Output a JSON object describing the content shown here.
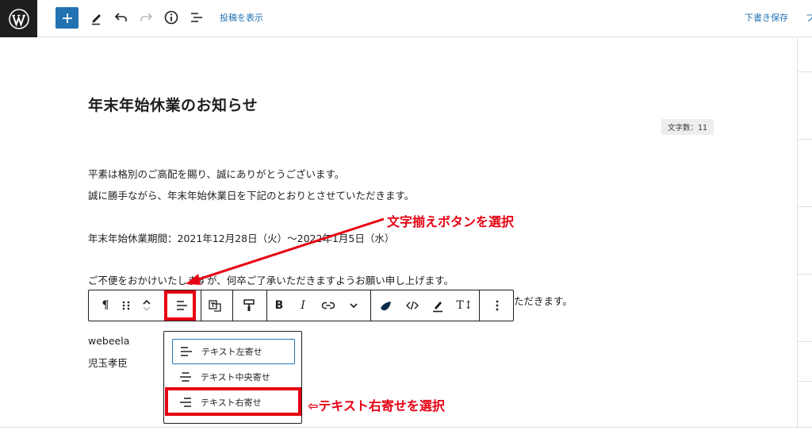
{
  "topbar": {
    "view_post": "投稿を表示",
    "save_draft": "下書き保存",
    "cut_text": "プ"
  },
  "post": {
    "title": "年末年始休業のお知らせ",
    "char_count": "文字数：11",
    "lines": [
      "平素は格別のご高配を賜り、誠にありがとうございます。",
      "誠に勝手ながら、年末年始休業日を下記のとおりとさせていただきます。",
      "年末年始休業期間：2021年12月28日（火）〜2022年1月5日（水）",
      "ご不便をおかけいたしますが、何卒ご了承いただきますようお願い申し上げます。",
      "ただきます。",
      "webeela",
      "児玉孝臣"
    ]
  },
  "block_toolbar": {
    "bold": "B",
    "italic": "I",
    "text_size": "T↕",
    "paragraph": "¶"
  },
  "align_menu": {
    "items": [
      {
        "label": "テキスト左寄せ",
        "icon": "align-left-icon"
      },
      {
        "label": "テキスト中央寄せ",
        "icon": "align-center-icon"
      },
      {
        "label": "テキスト右寄せ",
        "icon": "align-right-icon"
      }
    ]
  },
  "annotations": {
    "select_align_button": "文字揃えボタンを選択",
    "select_right_align": "⇦テキスト右寄せを選択"
  },
  "colors": {
    "accent": "#2271b1",
    "annotation": "#e60012"
  }
}
